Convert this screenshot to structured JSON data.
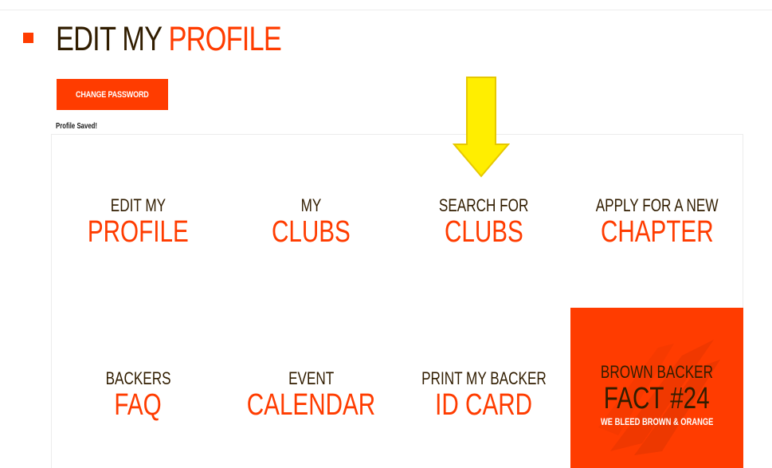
{
  "header": {
    "title_part1": "EDIT MY",
    "title_part2": "PROFILE"
  },
  "actions": {
    "change_password_label": "CHANGE PASSWORD"
  },
  "status": {
    "message": "Profile Saved!"
  },
  "menu": {
    "tiles": [
      {
        "top": "EDIT MY",
        "bottom": "PROFILE"
      },
      {
        "top": "MY",
        "bottom": "CLUBS"
      },
      {
        "top": "SEARCH FOR",
        "bottom": "CLUBS"
      },
      {
        "top": "APPLY FOR A NEW",
        "bottom": "CHAPTER"
      },
      {
        "top": "BACKERS",
        "bottom": "FAQ"
      },
      {
        "top": "EVENT",
        "bottom": "CALENDAR"
      },
      {
        "top": "PRINT MY BACKER",
        "bottom": "ID CARD"
      }
    ],
    "fact": {
      "top": "BROWN BACKER",
      "bottom": "FACT #24",
      "sub": "WE BLEED BROWN & ORANGE"
    }
  },
  "colors": {
    "brand_orange": "#ff3c00",
    "brand_brown": "#311d00",
    "annotation_yellow": "#ffee00"
  },
  "icons": {
    "title_bullet": "square-bullet-icon",
    "annotation": "down-arrow-icon",
    "fact_watermark": "helmet-stripes-icon"
  }
}
